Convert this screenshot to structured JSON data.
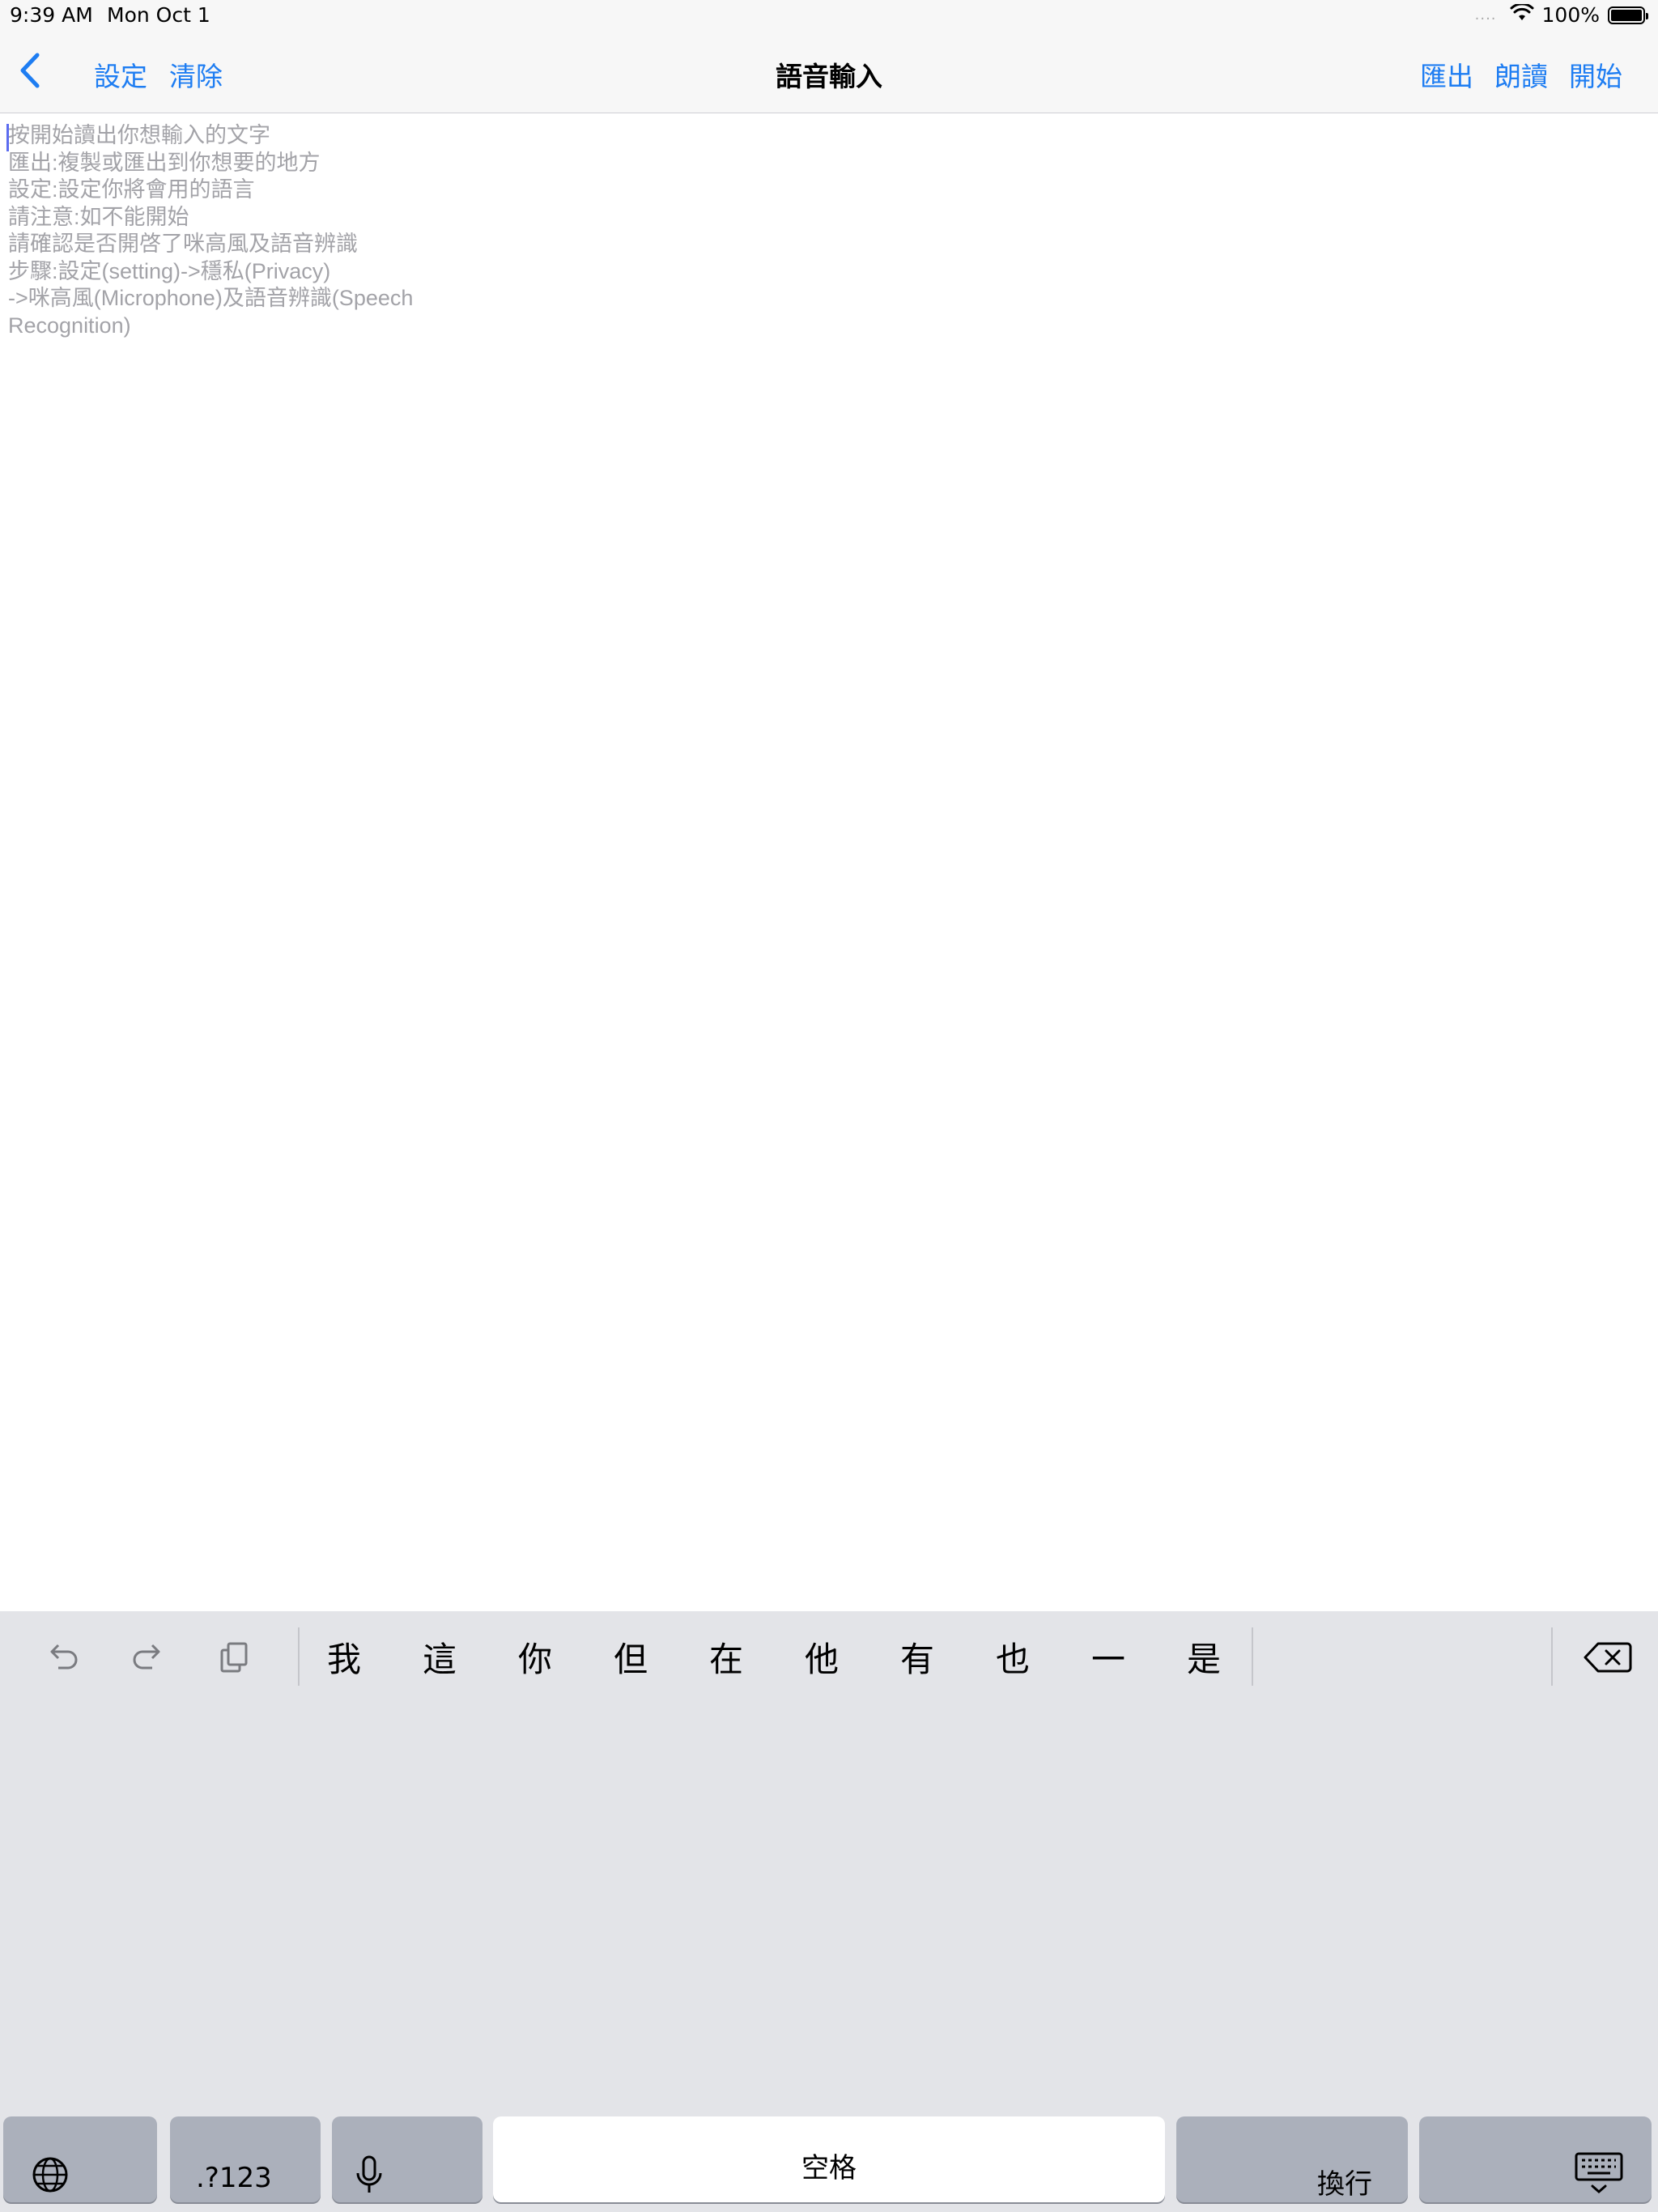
{
  "status_bar": {
    "time": "9:39 AM",
    "date": "Mon Oct 1",
    "battery_text": "100%",
    "signal_dots": "....",
    "battery_level": 1.0
  },
  "nav": {
    "title": "語音輸入",
    "left_buttons": [
      "設定",
      "清除"
    ],
    "right_buttons": [
      "匯出",
      "朗讀",
      "開始"
    ],
    "accent_color": "#1e7df2"
  },
  "editor": {
    "placeholder_lines": [
      "按開始讀出你想輸入的文字",
      "匯出:複製或匯出到你想要的地方",
      "設定:設定你將會用的語言",
      "請注意:如不能開始",
      "請確認是否開啓了咪高風及語音辨識",
      "步驟:設定(setting)->穩私(Privacy)",
      "->咪高風(Microphone)及語音辨識(Speech",
      "Recognition)"
    ]
  },
  "keyboard": {
    "candidates": [
      "我",
      "這",
      "你",
      "但",
      "在",
      "他",
      "有",
      "也",
      "一",
      "是"
    ],
    "keys": {
      "numbers_label": ".?123",
      "space_label": "空格",
      "return_label": "換行"
    },
    "icons": [
      "undo-icon",
      "redo-icon",
      "paste-icon",
      "delete-icon",
      "globe-icon",
      "mic-icon",
      "keyboard-dismiss-icon"
    ]
  }
}
